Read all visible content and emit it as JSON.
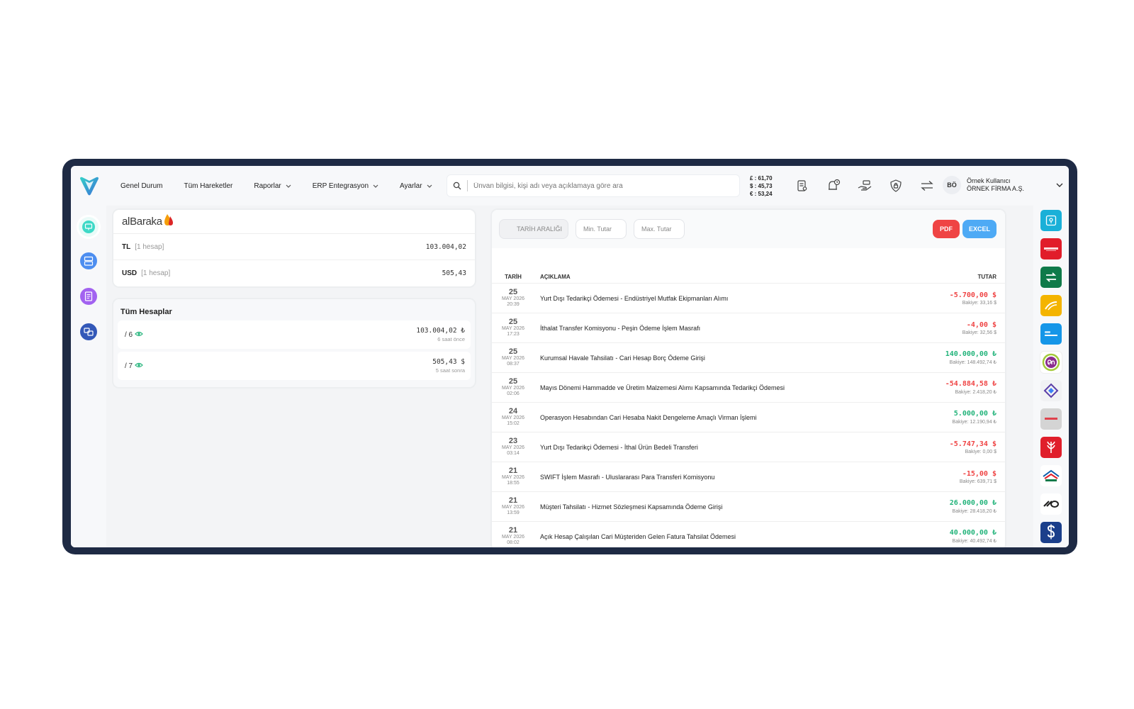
{
  "nav": {
    "items": [
      {
        "label": "Genel Durum",
        "dropdown": false
      },
      {
        "label": "Tüm Hareketler",
        "dropdown": false
      },
      {
        "label": "Raporlar",
        "dropdown": true
      },
      {
        "label": "ERP Entegrasyon",
        "dropdown": true
      },
      {
        "label": "Ayarlar",
        "dropdown": true
      }
    ]
  },
  "search": {
    "placeholder": "Ünvan bilgisi, kişi adı veya açıklamaya göre ara"
  },
  "rates": {
    "gbp": "£ : 61,70",
    "usd": "$ : 45,73",
    "eur": "€ : 53,24"
  },
  "user": {
    "initials": "BÖ",
    "name": "Örnek Kullanıcı",
    "company": "ÖRNEK FİRMA A.Ş."
  },
  "bank_summary": {
    "bank_name": "alBaraka",
    "rows": [
      {
        "currency": "TL",
        "count": "[1 hesap]",
        "amount": "103.004,02"
      },
      {
        "currency": "USD",
        "count": "[1 hesap]",
        "amount": "505,43"
      }
    ]
  },
  "accounts": {
    "title": "Tüm Hesaplar",
    "rows": [
      {
        "id": "/ 6",
        "amount": "103.004,02 ₺",
        "time": "6 saat önce"
      },
      {
        "id": "/ 7",
        "amount": "505,43 $",
        "time": "5 saat sonra"
      }
    ]
  },
  "tx_toolbar": {
    "date_range": "TARİH ARALIĞI",
    "min": "Min. Tutar",
    "max": "Max. Tutar",
    "pdf": "PDF",
    "excel": "EXCEL"
  },
  "tx_headers": {
    "date": "TARİH",
    "desc": "AÇIKLAMA",
    "amount": "TUTAR"
  },
  "transactions": [
    {
      "day": "25",
      "month": "MAY 2026",
      "time": "20:39",
      "desc": "Yurt Dışı Tedarikçi Ödemesi - Endüstriyel Mutfak Ekipmanları Alımı",
      "amount": "-5.700,00 $",
      "sign": "neg",
      "balance": "Bakiye: 33,16 $"
    },
    {
      "day": "25",
      "month": "MAY 2026",
      "time": "17:23",
      "desc": "İthalat Transfer Komisyonu - Peşin Ödeme İşlem Masrafı",
      "amount": "-4,00 $",
      "sign": "neg",
      "balance": "Bakiye: 32,56 $"
    },
    {
      "day": "25",
      "month": "MAY 2026",
      "time": "08:37",
      "desc": "Kurumsal Havale Tahsilatı - Cari Hesap Borç Ödeme Girişi",
      "amount": "140.000,00 ₺",
      "sign": "pos",
      "balance": "Bakiye: 148.492,74 ₺"
    },
    {
      "day": "25",
      "month": "MAY 2026",
      "time": "02:06",
      "desc": "Mayıs Dönemi Hammadde ve Üretim Malzemesi Alımı Kapsamında Tedarikçi Ödemesi",
      "amount": "-54.884,58 ₺",
      "sign": "neg",
      "balance": "Bakiye: 2.418,20 ₺"
    },
    {
      "day": "24",
      "month": "MAY 2026",
      "time": "15:02",
      "desc": "Operasyon Hesabından Cari Hesaba Nakit Dengeleme Amaçlı Virman İşlemi",
      "amount": "5.000,00 ₺",
      "sign": "pos",
      "balance": "Bakiye: 12.190,94 ₺"
    },
    {
      "day": "23",
      "month": "MAY 2026",
      "time": "03:14",
      "desc": "Yurt Dışı Tedarikçi Ödemesi - İthal Ürün Bedeli Transferi",
      "amount": "-5.747,34 $",
      "sign": "neg",
      "balance": "Bakiye: 0,00 $"
    },
    {
      "day": "21",
      "month": "MAY 2026",
      "time": "18:55",
      "desc": "SWIFT İşlem Masrafı - Uluslararası Para Transferi Komisyonu",
      "amount": "-15,00 $",
      "sign": "neg",
      "balance": "Bakiye: 639,71 $"
    },
    {
      "day": "21",
      "month": "MAY 2026",
      "time": "13:59",
      "desc": "Müşteri Tahsilatı - Hizmet Sözleşmesi Kapsamında Ödeme Girişi",
      "amount": "26.000,00 ₺",
      "sign": "pos",
      "balance": "Bakiye: 28.418,20 ₺"
    },
    {
      "day": "21",
      "month": "MAY 2026",
      "time": "08:02",
      "desc": "Açık Hesap Çalışılan Cari Müşteriden Gelen Fatura Tahsilat Ödemesi",
      "amount": "40.000,00 ₺",
      "sign": "pos",
      "balance": "Bakiye: 40.492,74 ₺"
    }
  ],
  "colors": {
    "accent": "#4eaaf5",
    "negative": "#ef4444",
    "positive": "#22b37a",
    "frame": "#1e2a44"
  }
}
